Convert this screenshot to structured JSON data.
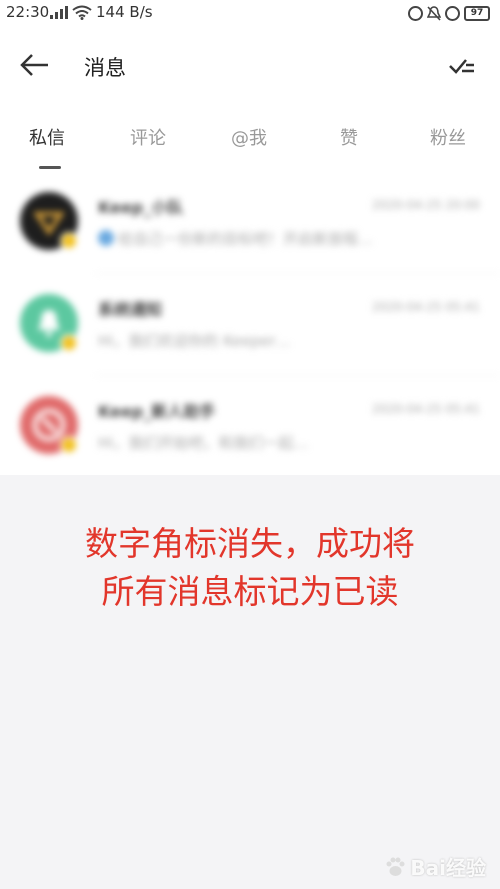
{
  "status_bar": {
    "time": "22:30",
    "network_speed": "144 B/s",
    "battery": "97"
  },
  "header": {
    "title": "消息"
  },
  "tabs": [
    {
      "label": "私信",
      "active": true
    },
    {
      "label": "评论",
      "active": false
    },
    {
      "label": "@我",
      "active": false
    },
    {
      "label": "赞",
      "active": false
    },
    {
      "label": "粉丝",
      "active": false
    }
  ],
  "messages": [
    {
      "name": "Keep_小队",
      "time": "2020-04-25 20:00",
      "preview": "给自己一份新的目标吧！开启新旅程…",
      "avatar_color": "#1e1e1e"
    },
    {
      "name": "系统通知",
      "time": "2020-04-25 05:41",
      "preview": "Hi，我们欢迎你的 Keeper…",
      "avatar_color": "#5cc8a0"
    },
    {
      "name": "Keep_新人助手",
      "time": "2020-04-25 05:41",
      "preview": "Hi，我们开始吧，和我们一起…",
      "avatar_color": "#e06a6a"
    }
  ],
  "annotation": {
    "line1": "数字角标消失，成功将",
    "line2": "所有消息标记为已读"
  },
  "colors": {
    "accent_badge": "#f2c11f",
    "annotation_red": "#e2362b"
  },
  "watermark": {
    "text": "Bai经验"
  }
}
